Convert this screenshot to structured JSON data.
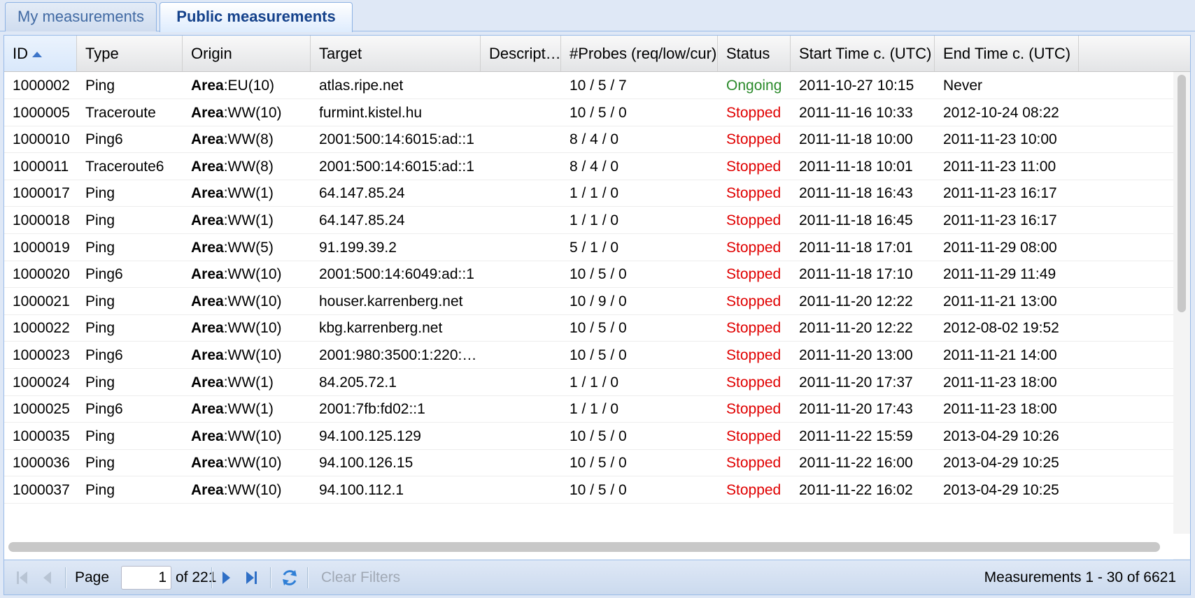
{
  "tabs": [
    {
      "label": "My measurements"
    },
    {
      "label": "Public measurements"
    }
  ],
  "columns": [
    {
      "label": "ID"
    },
    {
      "label": "Type"
    },
    {
      "label": "Origin"
    },
    {
      "label": "Target"
    },
    {
      "label": "Descript…"
    },
    {
      "label": "#Probes (req/low/cur)"
    },
    {
      "label": "Status"
    },
    {
      "label": "Start Time c. (UTC)"
    },
    {
      "label": "End Time c. (UTC)"
    }
  ],
  "sort": {
    "column": "ID",
    "direction": "ascending"
  },
  "origin_prefix": "Area",
  "rows": [
    {
      "id": "1000002",
      "type": "Ping",
      "origin": ":EU(10)",
      "target": "atlas.ripe.net",
      "desc": "",
      "probes": "10 / 5 / 7",
      "status": "Ongoing",
      "start": "2011-10-27 10:15",
      "end": "Never"
    },
    {
      "id": "1000005",
      "type": "Traceroute",
      "origin": ":WW(10)",
      "target": "furmint.kistel.hu",
      "desc": "",
      "probes": "10 / 5 / 0",
      "status": "Stopped",
      "start": "2011-11-16 10:33",
      "end": "2012-10-24 08:22"
    },
    {
      "id": "1000010",
      "type": "Ping6",
      "origin": ":WW(8)",
      "target": "2001:500:14:6015:ad::1",
      "desc": "",
      "probes": "8 / 4 / 0",
      "status": "Stopped",
      "start": "2011-11-18 10:00",
      "end": "2011-11-23 10:00"
    },
    {
      "id": "1000011",
      "type": "Traceroute6",
      "origin": ":WW(8)",
      "target": "2001:500:14:6015:ad::1",
      "desc": "",
      "probes": "8 / 4 / 0",
      "status": "Stopped",
      "start": "2011-11-18 10:01",
      "end": "2011-11-23 11:00"
    },
    {
      "id": "1000017",
      "type": "Ping",
      "origin": ":WW(1)",
      "target": "64.147.85.24",
      "desc": "",
      "probes": "1 / 1 / 0",
      "status": "Stopped",
      "start": "2011-11-18 16:43",
      "end": "2011-11-23 16:17"
    },
    {
      "id": "1000018",
      "type": "Ping",
      "origin": ":WW(1)",
      "target": "64.147.85.24",
      "desc": "",
      "probes": "1 / 1 / 0",
      "status": "Stopped",
      "start": "2011-11-18 16:45",
      "end": "2011-11-23 16:17"
    },
    {
      "id": "1000019",
      "type": "Ping",
      "origin": ":WW(5)",
      "target": "91.199.39.2",
      "desc": "",
      "probes": "5 / 1 / 0",
      "status": "Stopped",
      "start": "2011-11-18 17:01",
      "end": "2011-11-29 08:00"
    },
    {
      "id": "1000020",
      "type": "Ping6",
      "origin": ":WW(10)",
      "target": "2001:500:14:6049:ad::1",
      "desc": "",
      "probes": "10 / 5 / 0",
      "status": "Stopped",
      "start": "2011-11-18 17:10",
      "end": "2011-11-29 11:49"
    },
    {
      "id": "1000021",
      "type": "Ping",
      "origin": ":WW(10)",
      "target": "houser.karrenberg.net",
      "desc": "",
      "probes": "10 / 9 / 0",
      "status": "Stopped",
      "start": "2011-11-20 12:22",
      "end": "2011-11-21 13:00"
    },
    {
      "id": "1000022",
      "type": "Ping",
      "origin": ":WW(10)",
      "target": "kbg.karrenberg.net",
      "desc": "",
      "probes": "10 / 5 / 0",
      "status": "Stopped",
      "start": "2011-11-20 12:22",
      "end": "2012-08-02 19:52"
    },
    {
      "id": "1000023",
      "type": "Ping6",
      "origin": ":WW(10)",
      "target": "2001:980:3500:1:220:…",
      "desc": "",
      "probes": "10 / 5 / 0",
      "status": "Stopped",
      "start": "2011-11-20 13:00",
      "end": "2011-11-21 14:00"
    },
    {
      "id": "1000024",
      "type": "Ping",
      "origin": ":WW(1)",
      "target": "84.205.72.1",
      "desc": "",
      "probes": "1 / 1 / 0",
      "status": "Stopped",
      "start": "2011-11-20 17:37",
      "end": "2011-11-23 18:00"
    },
    {
      "id": "1000025",
      "type": "Ping6",
      "origin": ":WW(1)",
      "target": "2001:7fb:fd02::1",
      "desc": "",
      "probes": "1 / 1 / 0",
      "status": "Stopped",
      "start": "2011-11-20 17:43",
      "end": "2011-11-23 18:00"
    },
    {
      "id": "1000035",
      "type": "Ping",
      "origin": ":WW(10)",
      "target": "94.100.125.129",
      "desc": "",
      "probes": "10 / 5 / 0",
      "status": "Stopped",
      "start": "2011-11-22 15:59",
      "end": "2013-04-29 10:26"
    },
    {
      "id": "1000036",
      "type": "Ping",
      "origin": ":WW(10)",
      "target": "94.100.126.15",
      "desc": "",
      "probes": "10 / 5 / 0",
      "status": "Stopped",
      "start": "2011-11-22 16:00",
      "end": "2013-04-29 10:25"
    },
    {
      "id": "1000037",
      "type": "Ping",
      "origin": ":WW(10)",
      "target": "94.100.112.1",
      "desc": "",
      "probes": "10 / 5 / 0",
      "status": "Stopped",
      "start": "2011-11-22 16:02",
      "end": "2013-04-29 10:25"
    }
  ],
  "status_colors": {
    "Ongoing": "#2a8a2a",
    "Stopped": "#e00000"
  },
  "pager": {
    "page_label": "Page",
    "page_value": "1",
    "of_label": "of 221",
    "clear_filters": "Clear Filters",
    "summary": "Measurements 1 - 30 of 6621"
  },
  "icons": [
    "first-page-icon",
    "prev-page-icon",
    "next-page-icon",
    "last-page-icon",
    "refresh-icon"
  ]
}
